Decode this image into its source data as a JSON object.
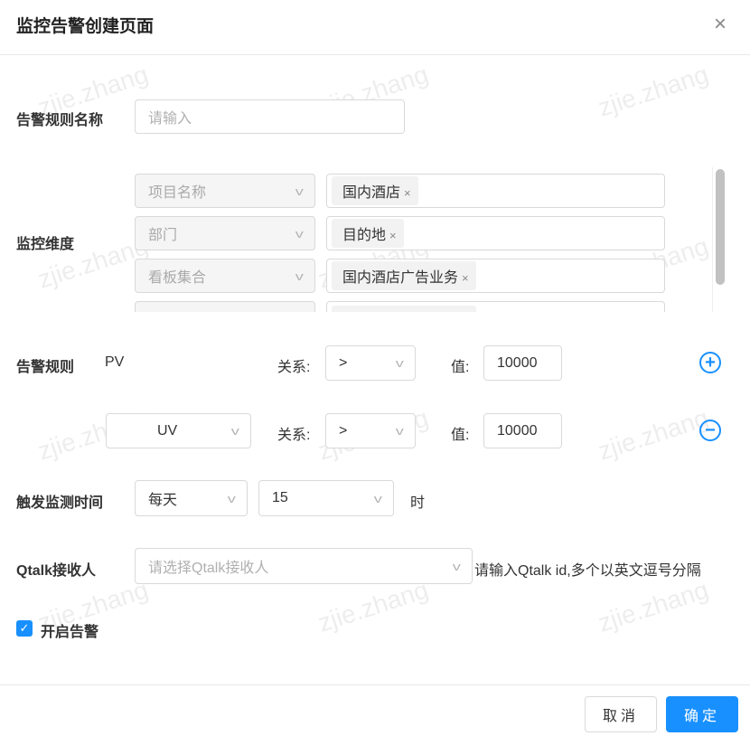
{
  "title": "监控告警创建页面",
  "close_label": "×",
  "watermark": "zjie.zhang",
  "name_field": {
    "label": "告警规则名称",
    "placeholder": "请输入"
  },
  "dimension": {
    "label": "监控维度",
    "rows": [
      {
        "field": "项目名称",
        "tags": [
          "国内酒店"
        ]
      },
      {
        "field": "部门",
        "tags": [
          "目的地"
        ]
      },
      {
        "field": "看板集合",
        "tags": [
          "国内酒店广告业务"
        ]
      }
    ]
  },
  "rules": {
    "label": "告警规则",
    "relation_label": "关系:",
    "value_label": "值:",
    "items": [
      {
        "metric": "PV",
        "relation": ">",
        "value": "10000",
        "action": "+"
      },
      {
        "metric": "UV",
        "relation": ">",
        "value": "10000",
        "action": "−"
      }
    ]
  },
  "trigger": {
    "label": "触发监测时间",
    "frequency": "每天",
    "hour": "15",
    "unit": "时"
  },
  "qtalk": {
    "label": "Qtalk接收人",
    "placeholder": "请选择Qtalk接收人",
    "hint": "请输入Qtalk id,多个以英文逗号分隔"
  },
  "enable": {
    "label": "开启告警",
    "checked": true
  },
  "footer": {
    "cancel": "取消",
    "ok": "确定"
  },
  "colors": {
    "primary": "#1890ff"
  }
}
